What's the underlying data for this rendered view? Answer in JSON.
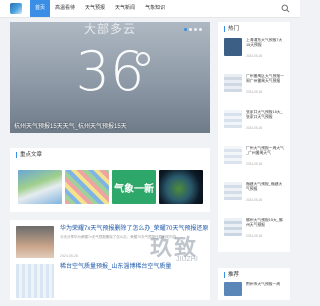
{
  "nav": {
    "items": [
      "首页",
      "高温看待",
      "天气预报",
      "天气新闻",
      "气象知识"
    ],
    "active_index": 0,
    "search_icon": "search-icon"
  },
  "hero": {
    "top_text": "大部多云",
    "temperature": "36",
    "caption": "杭州天气预报15天天气_杭州天气预报15天"
  },
  "recommended": {
    "title": "重点文章",
    "banner_text": "气象一新"
  },
  "articles": [
    {
      "title": "华为荣耀7x天气预报删除了怎么办_荣耀70天气预报还原",
      "body": "今天分享华为荣耀7x天气预报删除了怎么办，荣耀70天气预报还原相关内容……",
      "date": "2024-05-26"
    },
    {
      "title": "稀台空气质量预报_山东淄博稀台空气质量",
      "body": "",
      "date": ""
    }
  ],
  "hot": {
    "title": "热门",
    "items": [
      {
        "title": "上海浦东天气预报7天15天预报",
        "date": "2024-05-26"
      },
      {
        "title": "广州番禺区天气预报一周广州番禺天气预报",
        "date": "2024-05-26"
      },
      {
        "title": "张家口天气预报15天_张家口天气预报",
        "date": "2024-05-26"
      },
      {
        "title": "广州天气预报一周天气_广州番禺天气",
        "date": "2024-05-26"
      },
      {
        "title": "福建天气预报_福建天气预报",
        "date": "2024-05-26"
      },
      {
        "title": "佛州天气预报15天_佛州天气预报",
        "date": "2024-05-26"
      }
    ]
  },
  "sidebar_recommend": {
    "title": "推荐",
    "first_item": "荆州市天气预报一周"
  },
  "watermark": {
    "main": "玖致",
    "sub": "JIUZHI"
  }
}
